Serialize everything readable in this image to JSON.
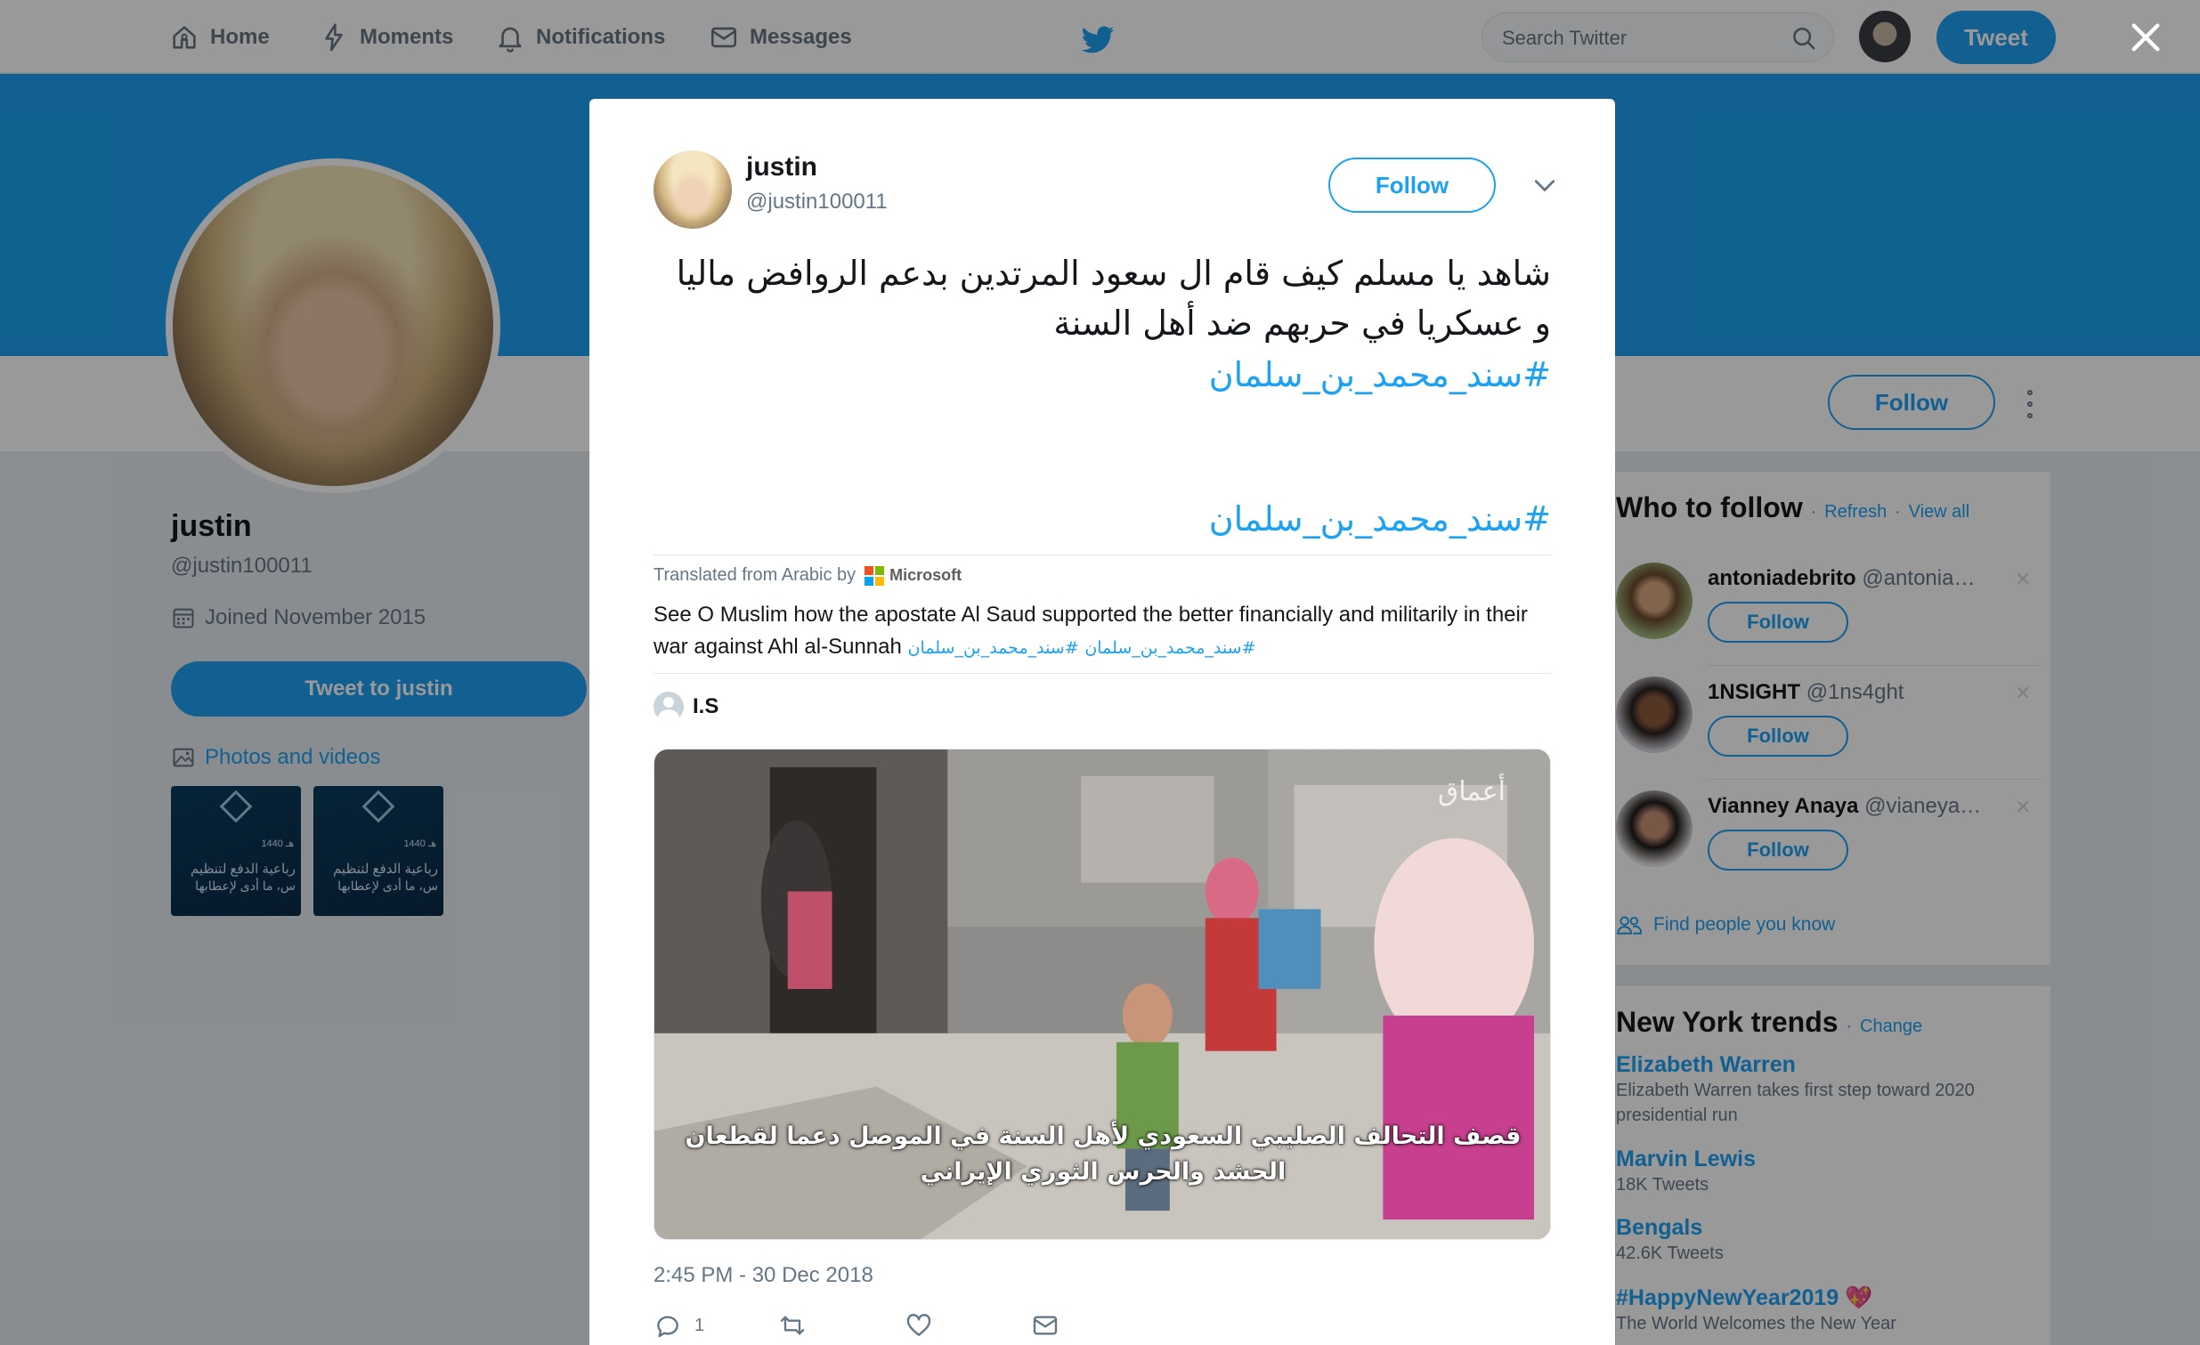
{
  "nav": {
    "home": "Home",
    "moments": "Moments",
    "notifications": "Notifications",
    "messages": "Messages",
    "search_placeholder": "Search Twitter",
    "tweet_button": "Tweet"
  },
  "profile": {
    "name": "justin",
    "handle": "@justin100011",
    "joined": "Joined November 2015",
    "tweet_to": "Tweet to justin",
    "photos_videos": "Photos and videos",
    "follow": "Follow",
    "thumbs": [
      {
        "date": "1440 هـ",
        "line1": "رباعية الدفع لتنظيم",
        "line2": "س، ما أدى لإعطابها"
      },
      {
        "date": "1440 هـ",
        "line1": "رباعية الدفع لتنظيم",
        "line2": "س، ما أدى لإعطابها"
      }
    ]
  },
  "who_to_follow": {
    "title": "Who to follow",
    "refresh": "Refresh",
    "view_all": "View all",
    "dot": "·",
    "users": [
      {
        "name": "antoniadebrito",
        "handle": "@antonia…",
        "follow": "Follow"
      },
      {
        "name": "1NSIGHT",
        "handle": "@1ns4ght",
        "follow": "Follow"
      },
      {
        "name": "Vianney Anaya",
        "handle": "@vianeya…",
        "follow": "Follow"
      }
    ],
    "find_people": "Find people you know"
  },
  "trends": {
    "title": "New York trends",
    "change": "Change",
    "items": [
      {
        "name": "Elizabeth Warren",
        "desc": "Elizabeth Warren takes first step toward 2020 presidential run"
      },
      {
        "name": "Marvin Lewis",
        "desc": "18K Tweets"
      },
      {
        "name": "Bengals",
        "desc": "42.6K Tweets"
      },
      {
        "name": "#HappyNewYear2019",
        "desc": "The World Welcomes the New Year"
      }
    ]
  },
  "tweet": {
    "author_name": "justin",
    "author_handle": "@justin100011",
    "follow": "Follow",
    "text_arabic": "شاهد يا مسلم كيف قام ال سعود المرتدين بدعم الروافض ماليا و عسكريا في حربهم ضد أهل السنة",
    "hashtag_1": "#سند_محمد_بن_سلمان",
    "hashtag_2": "#سند_محمد_بن_سلمان",
    "translated_from": "Translated from Arabic by",
    "translator": "Microsoft",
    "translation": "See O Muslim how the apostate Al Saud supported the better financially and militarily in their war against Ahl al-Sunnah",
    "translation_tag_1": "#سند_محمد_بن_سلمان",
    "translation_tag_2": "#سند_محمد_بن_سلمان",
    "quoted_user": "I.S",
    "video_watermark": "أعماق",
    "video_subtitle": "قصف التحالف الصليبي السعودي لأهل السنة في الموصل دعما لقطعان الحشد والحرس الثوري الإيراني",
    "timestamp": "2:45 PM - 30 Dec 2018",
    "reply_count": "1"
  },
  "colors": {
    "accent": "#1da1f2",
    "secondary_text": "#657786",
    "microsoft": [
      "#f25022",
      "#7fba00",
      "#00a4ef",
      "#ffb900"
    ]
  }
}
